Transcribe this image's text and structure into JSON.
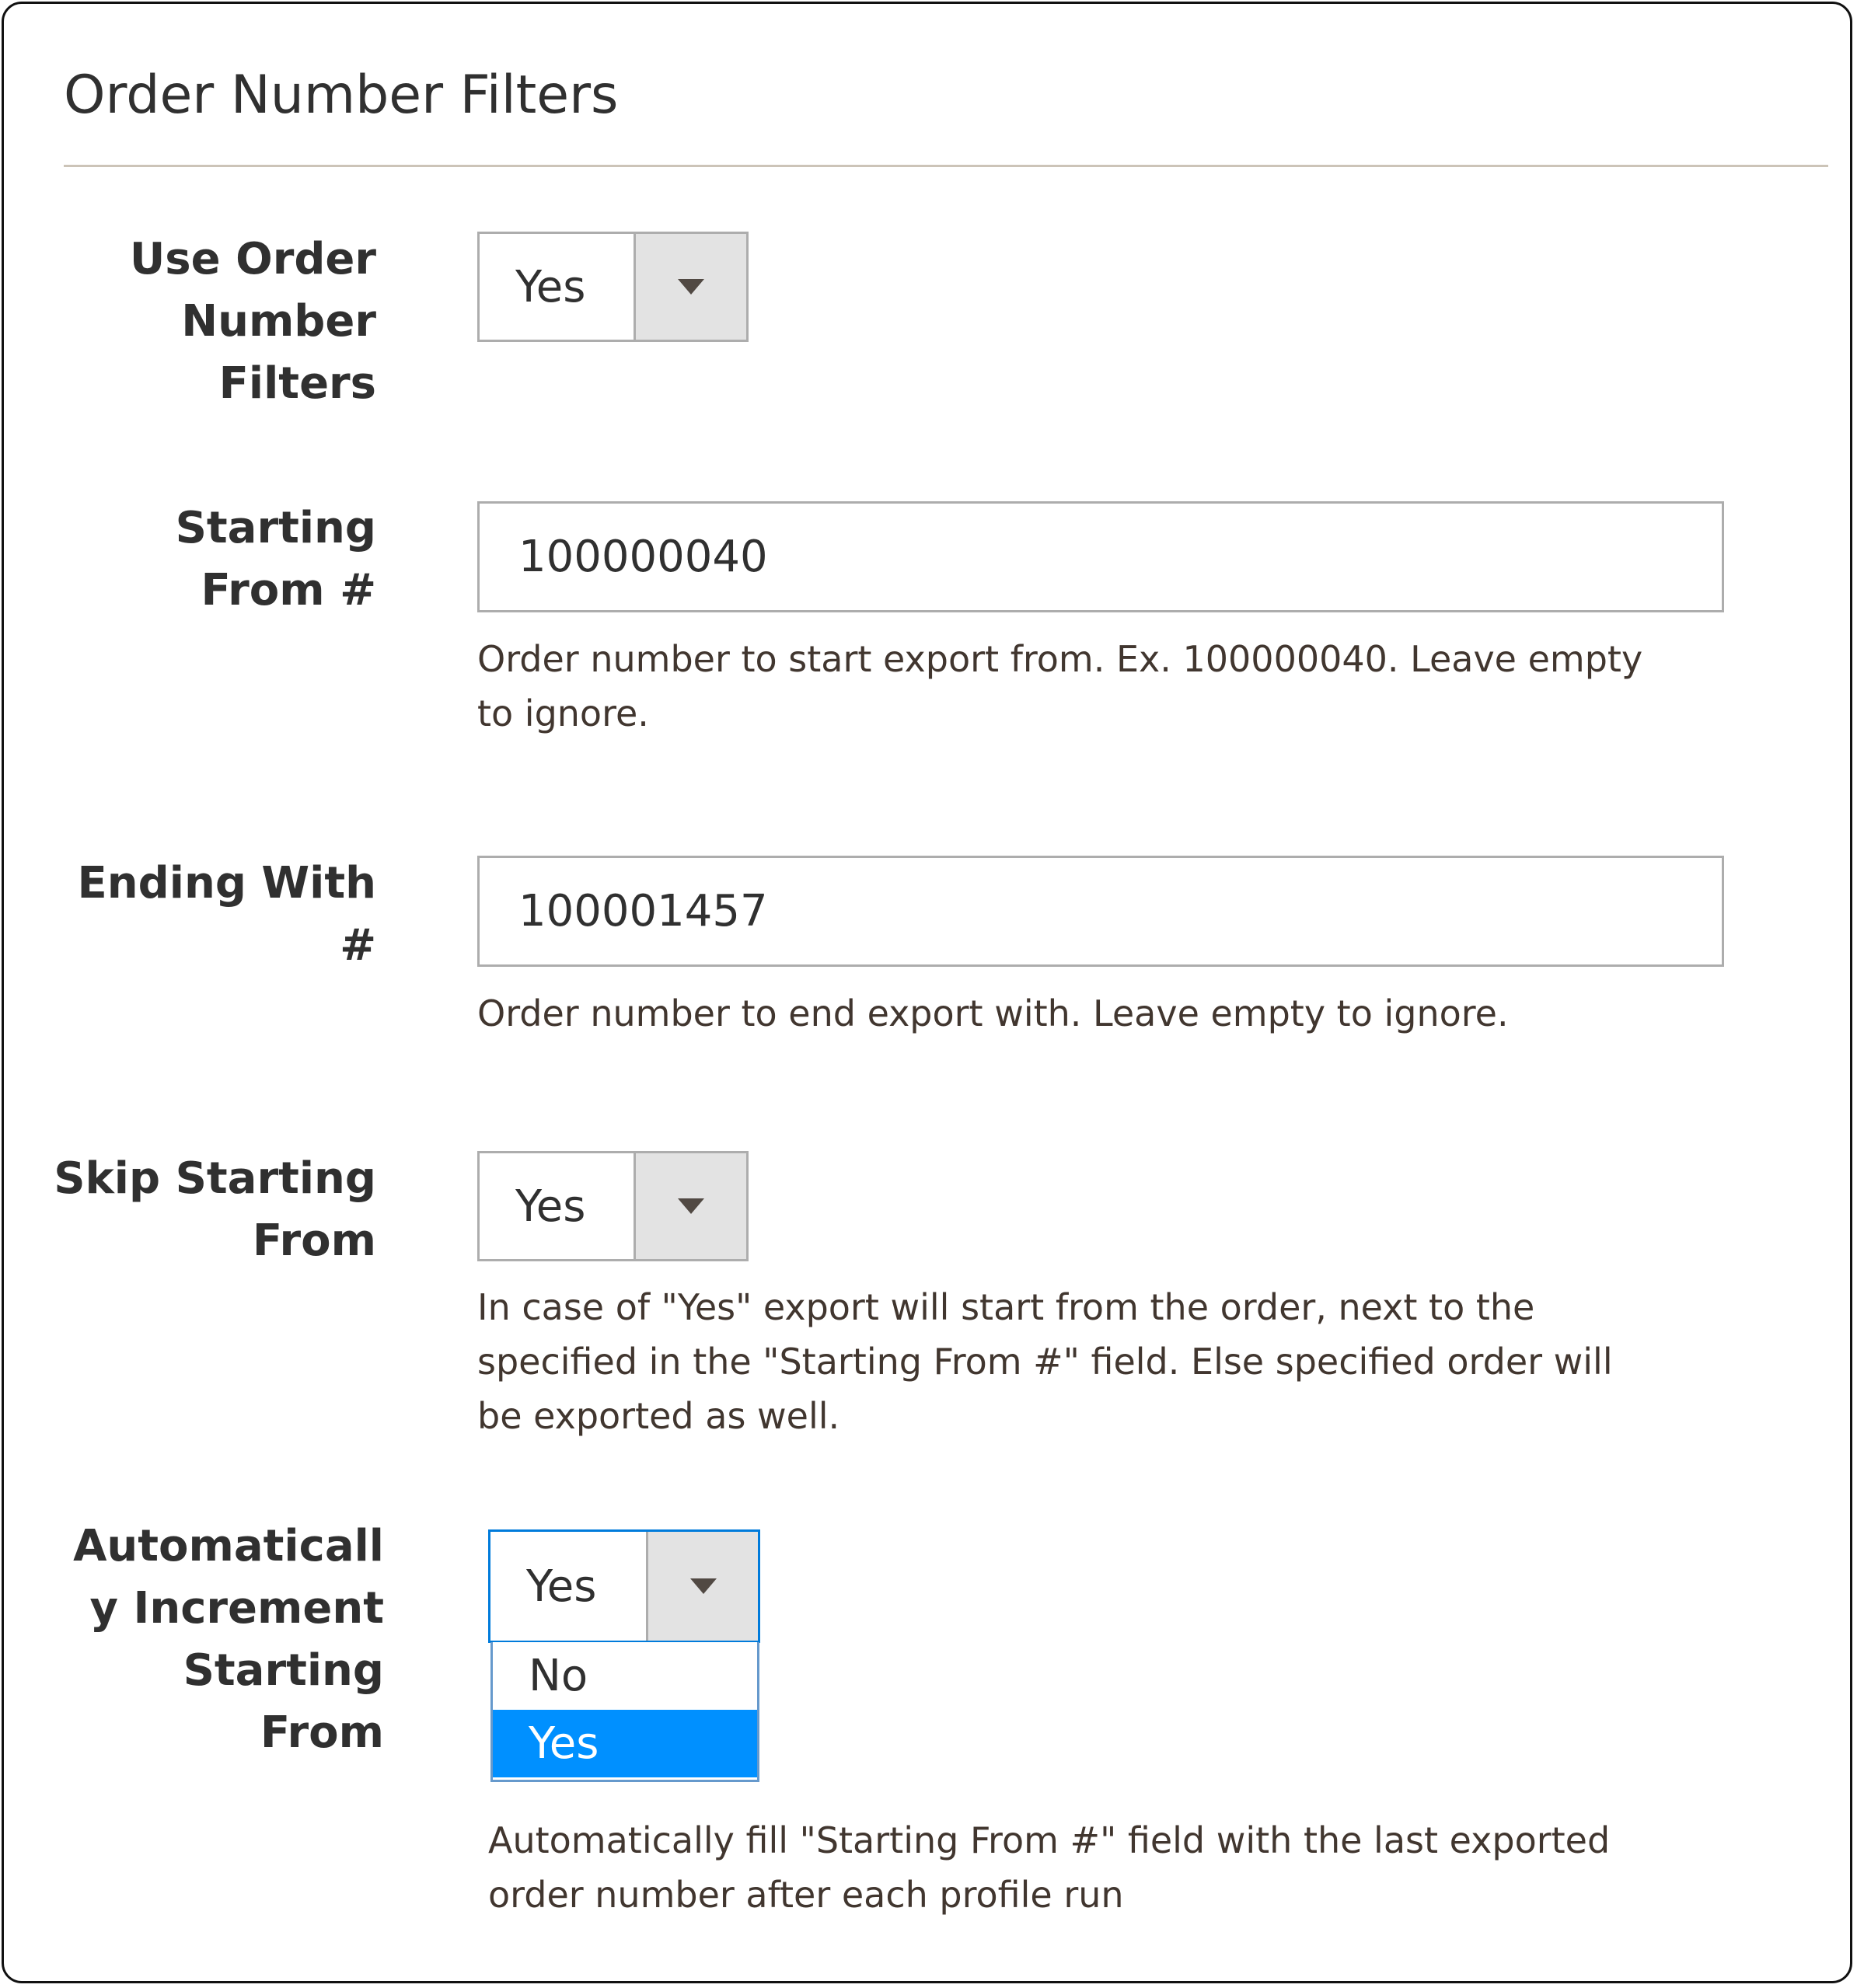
{
  "section": {
    "title": "Order Number Filters"
  },
  "fields": {
    "use_filters": {
      "label_lines": [
        "Use Order",
        "Number",
        "Filters"
      ],
      "value": "Yes"
    },
    "starting_from": {
      "label_lines": [
        "Starting",
        "From #"
      ],
      "value": "100000040",
      "note_lines": [
        "Order number to start export from. Ex. 100000040. Leave empty",
        "to ignore."
      ]
    },
    "ending_with": {
      "label_lines": [
        "Ending With",
        "#"
      ],
      "value": "100001457",
      "note_lines": [
        "Order number to end export with. Leave empty to ignore."
      ]
    },
    "skip_starting": {
      "label_lines": [
        "Skip Starting",
        "From"
      ],
      "value": "Yes",
      "note_lines": [
        "In case of \"Yes\" export will start from the order, next to the",
        "specified in the \"Starting From #\" field. Else specified order will",
        "be exported as well."
      ]
    },
    "auto_increment": {
      "label_lines": [
        "Automaticall",
        "y Increment",
        "Starting",
        "From"
      ],
      "value": "Yes",
      "options": [
        "No",
        "Yes"
      ],
      "selected_option": "Yes",
      "note_lines": [
        "Automatically fill \"Starting From #\" field with the last exported",
        "order number after each profile run"
      ]
    }
  },
  "icons": {
    "dropdown_arrow": "chevron-down-icon"
  },
  "colors": {
    "focus_border": "#007bdb",
    "option_highlight": "#0090ff",
    "divider": "#ccc4b8"
  }
}
